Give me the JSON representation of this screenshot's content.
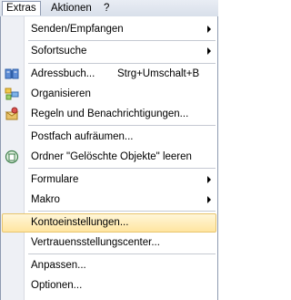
{
  "menubar": {
    "items": [
      {
        "label": "Extras",
        "active": true
      },
      {
        "label": "Aktionen",
        "active": false
      },
      {
        "label": "?",
        "active": false
      }
    ]
  },
  "menu": {
    "items": [
      {
        "label": "Senden/Empfangen",
        "submenu": true
      },
      {
        "label": "Sofortsuche",
        "submenu": true
      },
      {
        "label": "Adressbuch...",
        "shortcut": "Strg+Umschalt+B",
        "icon": "address-book-icon"
      },
      {
        "label": "Organisieren",
        "icon": "organize-icon"
      },
      {
        "label": "Regeln und Benachrichtigungen...",
        "icon": "rules-icon"
      },
      {
        "label": "Postfach aufräumen..."
      },
      {
        "label": "Ordner \"Gelöschte Objekte\" leeren",
        "icon": "empty-folder-icon"
      },
      {
        "label": "Formulare",
        "submenu": true
      },
      {
        "label": "Makro",
        "submenu": true
      },
      {
        "label": "Kontoeinstellungen...",
        "highlighted": true
      },
      {
        "label": "Vertrauensstellungscenter..."
      },
      {
        "label": "Anpassen..."
      },
      {
        "label": "Optionen..."
      }
    ]
  },
  "colors": {
    "highlight": "#ffe5a0",
    "highlight_border": "#e8c56d",
    "icon_strip": "#eef0f5"
  }
}
